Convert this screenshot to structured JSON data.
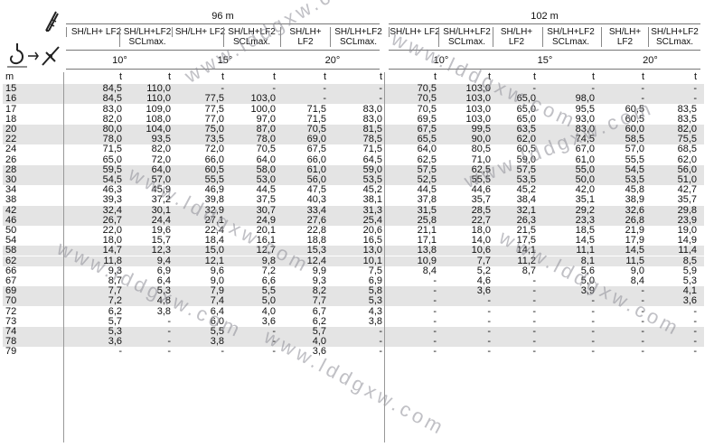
{
  "icons": [
    "boom-config-icon",
    "rigging-icon",
    "hook-icon",
    "counterweight-icon"
  ],
  "groups": [
    {
      "label": "96 m",
      "subheaders": [
        "SH/LH+ LF2",
        "SH/LH+LF2 SCLmax.",
        "SH/LH+ LF2",
        "SH/LH+LF2 SCLmax.",
        "SH/LH+ LF2",
        "SH/LH+LF2 SCLmax."
      ],
      "angles": [
        "10°",
        "15°",
        "20°"
      ]
    },
    {
      "label": "102 m",
      "subheaders": [
        "SH/LH+ LF2",
        "SH/LH+LF2 SCLmax.",
        "SH/LH+ LF2",
        "SH/LH+LF2 SCLmax.",
        "SH/LH+ LF2",
        "SH/LH+LF2 SCLmax."
      ],
      "angles": [
        "10°",
        "15°",
        "20°"
      ]
    }
  ],
  "units_row": [
    "m",
    "t",
    "t",
    "t",
    "t",
    "t",
    "t",
    "t",
    "t",
    "t",
    "t",
    "t",
    "t"
  ],
  "rows": [
    [
      "15",
      "84,5",
      "110,0",
      "-",
      "-",
      "-",
      "-",
      "70,5",
      "103,0",
      "-",
      "-",
      "-",
      "-"
    ],
    [
      "16",
      "84,5",
      "110,0",
      "77,5",
      "103,0",
      "-",
      "-",
      "70,5",
      "103,0",
      "65,0",
      "98,0",
      "-",
      "-"
    ],
    [
      "17",
      "83,0",
      "109,0",
      "77,5",
      "100,0",
      "71,5",
      "83,0",
      "70,5",
      "103,0",
      "65,0",
      "95,5",
      "60,5",
      "83,5"
    ],
    [
      "18",
      "82,0",
      "108,0",
      "77,0",
      "97,0",
      "71,5",
      "83,0",
      "69,5",
      "103,0",
      "65,0",
      "93,0",
      "60,5",
      "83,5"
    ],
    [
      "20",
      "80,0",
      "104,0",
      "75,0",
      "87,0",
      "70,5",
      "81,5",
      "67,5",
      "99,5",
      "63,5",
      "83,0",
      "60,0",
      "82,0"
    ],
    [
      "22",
      "78,0",
      "93,5",
      "73,5",
      "78,0",
      "69,0",
      "78,5",
      "65,5",
      "90,0",
      "62,0",
      "74,5",
      "58,5",
      "75,5"
    ],
    [
      "24",
      "71,5",
      "82,0",
      "72,0",
      "70,5",
      "67,5",
      "71,5",
      "64,0",
      "80,5",
      "60,5",
      "67,0",
      "57,0",
      "68,5"
    ],
    [
      "26",
      "65,0",
      "72,0",
      "66,0",
      "64,0",
      "66,0",
      "64,5",
      "62,5",
      "71,0",
      "59,0",
      "61,0",
      "55,5",
      "62,0"
    ],
    [
      "28",
      "59,5",
      "64,0",
      "60,5",
      "58,0",
      "61,0",
      "59,0",
      "57,5",
      "62,5",
      "57,5",
      "55,0",
      "54,5",
      "56,0"
    ],
    [
      "30",
      "54,5",
      "57,0",
      "55,5",
      "53,0",
      "56,0",
      "53,5",
      "52,5",
      "55,5",
      "53,5",
      "50,0",
      "53,5",
      "51,0"
    ],
    [
      "34",
      "46,3",
      "45,9",
      "46,9",
      "44,5",
      "47,5",
      "45,2",
      "44,5",
      "44,6",
      "45,2",
      "42,0",
      "45,8",
      "42,7"
    ],
    [
      "38",
      "39,3",
      "37,2",
      "39,8",
      "37,5",
      "40,3",
      "38,1",
      "37,8",
      "35,7",
      "38,4",
      "35,1",
      "38,9",
      "35,7"
    ],
    [
      "42",
      "32,4",
      "30,1",
      "32,9",
      "30,7",
      "33,4",
      "31,3",
      "31,5",
      "28,5",
      "32,1",
      "29,2",
      "32,6",
      "29,8"
    ],
    [
      "46",
      "26,7",
      "24,4",
      "27,1",
      "24,9",
      "27,6",
      "25,4",
      "25,8",
      "22,7",
      "26,3",
      "23,3",
      "26,8",
      "23,9"
    ],
    [
      "50",
      "22,0",
      "19,6",
      "22,4",
      "20,1",
      "22,8",
      "20,6",
      "21,1",
      "18,0",
      "21,5",
      "18,5",
      "21,9",
      "19,0"
    ],
    [
      "54",
      "18,0",
      "15,7",
      "18,4",
      "16,1",
      "18,8",
      "16,5",
      "17,1",
      "14,0",
      "17,5",
      "14,5",
      "17,9",
      "14,9"
    ],
    [
      "58",
      "14,7",
      "12,3",
      "15,0",
      "12,7",
      "15,3",
      "13,0",
      "13,8",
      "10,6",
      "14,1",
      "11,1",
      "14,5",
      "11,4"
    ],
    [
      "62",
      "11,8",
      "9,4",
      "12,1",
      "9,8",
      "12,4",
      "10,1",
      "10,9",
      "7,7",
      "11,2",
      "8,1",
      "11,5",
      "8,5"
    ],
    [
      "66",
      "9,3",
      "6,9",
      "9,6",
      "7,2",
      "9,9",
      "7,5",
      "8,4",
      "5,2",
      "8,7",
      "5,6",
      "9,0",
      "5,9"
    ],
    [
      "67",
      "8,7",
      "6,4",
      "9,0",
      "6,6",
      "9,3",
      "6,9",
      "-",
      "4,6",
      "-",
      "5,0",
      "8,4",
      "5,3"
    ],
    [
      "69",
      "7,7",
      "5,3",
      "7,9",
      "5,5",
      "8,2",
      "5,8",
      "-",
      "3,6",
      "-",
      "3,9",
      "-",
      "4,1"
    ],
    [
      "70",
      "7,2",
      "4,8",
      "7,4",
      "5,0",
      "7,7",
      "5,3",
      "-",
      "-",
      "-",
      "-",
      "-",
      "3,6"
    ],
    [
      "72",
      "6,2",
      "3,8",
      "6,4",
      "4,0",
      "6,7",
      "4,3",
      "-",
      "-",
      "-",
      "-",
      "-",
      "-"
    ],
    [
      "73",
      "5,7",
      "-",
      "6,0",
      "3,6",
      "6,2",
      "3,8",
      "-",
      "-",
      "-",
      "-",
      "-",
      "-"
    ],
    [
      "74",
      "5,3",
      "-",
      "5,5",
      "-",
      "5,7",
      "-",
      "-",
      "-",
      "-",
      "-",
      "-",
      "-"
    ],
    [
      "78",
      "3,6",
      "-",
      "3,8",
      "-",
      "4,0",
      "-",
      "-",
      "-",
      "-",
      "-",
      "-",
      "-"
    ],
    [
      "79",
      "-",
      "-",
      "-",
      "-",
      "3,6",
      "-",
      "-",
      "-",
      "-",
      "-",
      "-",
      "-"
    ]
  ],
  "watermark": "www.lddgxw.com"
}
